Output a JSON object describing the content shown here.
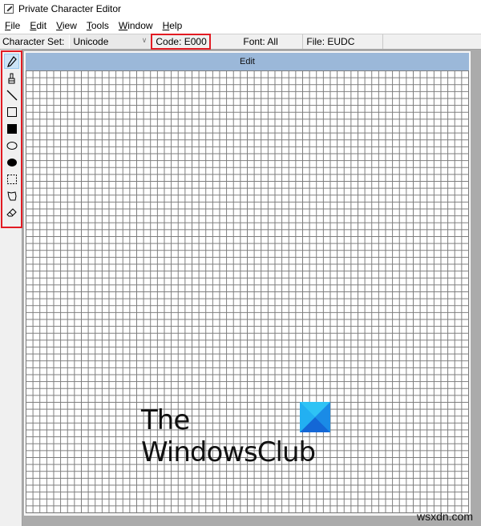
{
  "window": {
    "title": "Private Character Editor",
    "app_icon": "character-editor-icon"
  },
  "menu": [
    {
      "label": "File",
      "accel": "F",
      "rest": "ile"
    },
    {
      "label": "Edit",
      "accel": "E",
      "rest": "dit"
    },
    {
      "label": "View",
      "accel": "V",
      "rest": "iew"
    },
    {
      "label": "Tools",
      "accel": "T",
      "rest": "ools"
    },
    {
      "label": "Window",
      "accel": "W",
      "rest": "indow"
    },
    {
      "label": "Help",
      "accel": "H",
      "rest": "elp"
    }
  ],
  "infobar": {
    "character_set_label": "Character Set:",
    "character_set_value": "Unicode",
    "code": "Code: E000",
    "font": "Font: All",
    "file": "File: EUDC"
  },
  "tools": [
    {
      "name": "pencil",
      "icon": "pencil-icon",
      "active": true
    },
    {
      "name": "brush",
      "icon": "brush-icon",
      "active": false
    },
    {
      "name": "line",
      "icon": "line-icon",
      "active": false
    },
    {
      "name": "hollow-rectangle",
      "icon": "rectangle-outline-icon",
      "active": false
    },
    {
      "name": "filled-rectangle",
      "icon": "rectangle-filled-icon",
      "active": false
    },
    {
      "name": "hollow-ellipse",
      "icon": "ellipse-outline-icon",
      "active": false
    },
    {
      "name": "filled-ellipse",
      "icon": "ellipse-filled-icon",
      "active": false
    },
    {
      "name": "rectangular-selection",
      "icon": "rect-select-icon",
      "active": false
    },
    {
      "name": "freeform-selection",
      "icon": "freeform-select-icon",
      "active": false
    },
    {
      "name": "eraser",
      "icon": "eraser-icon",
      "active": false
    }
  ],
  "edit_window": {
    "title": "Edit",
    "grid_cells": "64x64"
  },
  "overlay": {
    "logo_line1": "The",
    "logo_line2": "WindowsClub",
    "watermark": "wsxdn.com"
  },
  "colors": {
    "highlight_red": "#e21b23",
    "edit_header": "#9bb8d9",
    "active_tool": "#cce4f7",
    "workspace": "#ababab"
  }
}
